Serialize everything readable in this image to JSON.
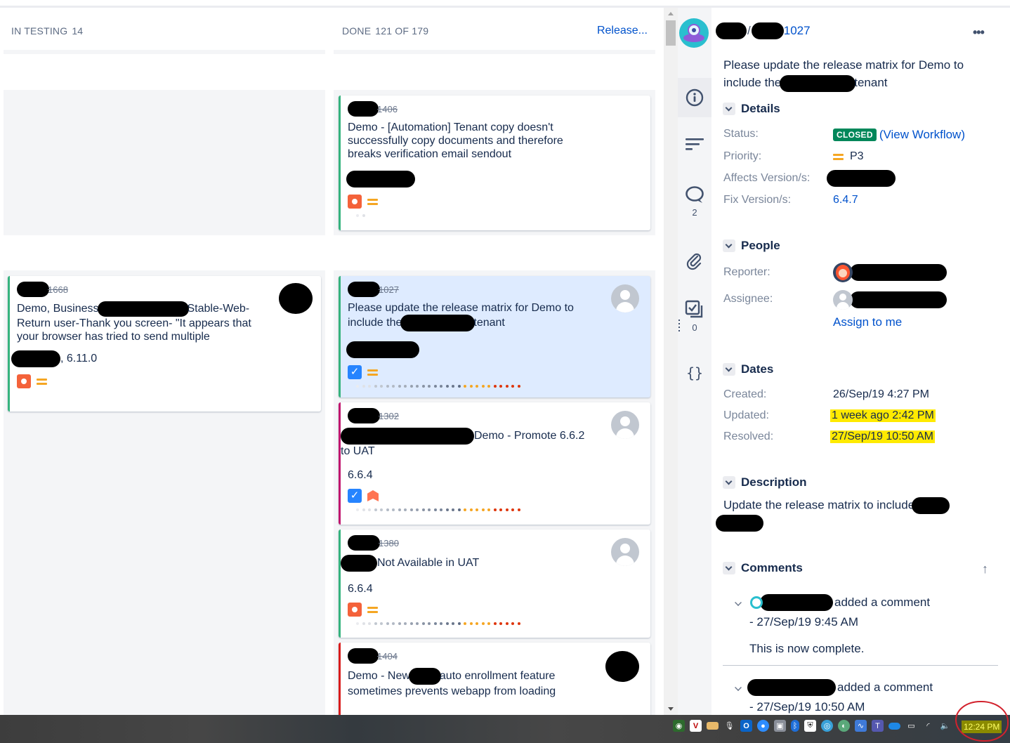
{
  "board": {
    "columns": [
      {
        "name": "IN TESTING",
        "count": "14"
      },
      {
        "name": "DONE",
        "count": "121 OF 179",
        "action_link": "Release..."
      }
    ],
    "cards": [
      {
        "key": "1406",
        "summary": "Demo - [Automation] Tenant copy doesn't successfully copy documents and therefore breaks verification email sendout",
        "version": "",
        "type": "bug",
        "priority": "medium",
        "border_color": "#36b37e",
        "selected": false
      },
      {
        "key": "1668",
        "summary_parts": [
          "Demo, Business",
          "Stable-Web-Return user-Thank you screen- \"It appears that your browser has tried to send multiple"
        ],
        "version": ", 6.11.0",
        "type": "bug",
        "priority": "medium",
        "border_color": "#36b37e",
        "selected": false
      },
      {
        "key": "1027",
        "summary_parts": [
          "Please update the release matrix for Demo to include the",
          "tenant"
        ],
        "version": "",
        "type": "task",
        "priority": "medium",
        "border_color": "#36b37e",
        "selected": true
      },
      {
        "key": "1302",
        "summary_parts": [
          "Demo - Promote 6.6.2 to UAT"
        ],
        "version": "6.6.4",
        "type": "task",
        "priority": "high",
        "border_color": "#c0166e",
        "selected": false
      },
      {
        "key": "1380",
        "summary_parts": [
          "Not Available in UAT"
        ],
        "version": "6.6.4",
        "type": "bug",
        "priority": "medium",
        "border_color": "#36b37e",
        "selected": false
      },
      {
        "key": "1404",
        "summary_parts": [
          "Demo - New",
          "auto enrollment feature sometimes prevents webapp from loading"
        ],
        "version": "",
        "type": "bug",
        "priority": "medium",
        "border_color": "#d91c1c",
        "selected": false
      }
    ],
    "days_in_column_dot_colors": [
      "#ebecf0",
      "#dfe1e6",
      "#dfe1e6",
      "#c1c7d0",
      "#c1c7d0",
      "#b3bac5",
      "#b3bac5",
      "#a5adba",
      "#a5adba",
      "#97a0af",
      "#97a0af",
      "#8993a4",
      "#8993a4",
      "#7a869a",
      "#7a869a",
      "#6b778c",
      "#6b778c",
      "#5e6c84",
      "#f5a623",
      "#f5a623",
      "#f5a623",
      "#f5a623",
      "#f5a623",
      "#de350b",
      "#de350b",
      "#de350b",
      "#de350b",
      "#de350b"
    ]
  },
  "rail": {
    "items": [
      {
        "icon": "info-icon",
        "count": ""
      },
      {
        "icon": "description-icon",
        "count": ""
      },
      {
        "icon": "comment-icon",
        "count": "2"
      },
      {
        "icon": "attachment-icon",
        "count": ""
      },
      {
        "icon": "subtasks-icon",
        "count": "0"
      },
      {
        "icon": "code-icon",
        "count": ""
      }
    ]
  },
  "detail": {
    "breadcrumb_sep": "/",
    "issue_key": "1027",
    "more": "•••",
    "title_parts": [
      "Please update the release matrix for Demo to include the",
      "tenant"
    ],
    "sections": {
      "details": "Details",
      "people": "People",
      "dates": "Dates",
      "description": "Description",
      "comments": "Comments"
    },
    "fields": {
      "status_label": "Status:",
      "status_value": "CLOSED",
      "status_link": "(View Workflow)",
      "priority_label": "Priority:",
      "priority_value": "P3",
      "affects_label": "Affects Version/s:",
      "fix_label": "Fix Version/s:",
      "fix_value": "6.4.7",
      "reporter_label": "Reporter:",
      "assignee_label": "Assignee:",
      "assign_to_me": "Assign to me",
      "created_label": "Created:",
      "created_value": "26/Sep/19 4:27 PM",
      "updated_label": "Updated:",
      "updated_value": "1 week ago 2:42 PM",
      "resolved_label": "Resolved:",
      "resolved_value": "27/Sep/19 10:50 AM"
    },
    "description": "Update the release matrix to include",
    "comments": [
      {
        "action": "added a comment",
        "date": "- 27/Sep/19 9:45 AM",
        "body": "This is now complete."
      },
      {
        "action": "added a comment",
        "date": "- 27/Sep/19 10:50 AM",
        "body": ""
      }
    ],
    "sort_arrow": "↑"
  },
  "taskbar": {
    "tray_icons": [
      "nvidia-icon",
      "app-v-icon",
      "mail-icon",
      "microphone-icon",
      "outlook-icon",
      "zoom-icon",
      "device-icon",
      "bluetooth-icon",
      "security-icon",
      "network-globe-icon",
      "browser-icon",
      "monitor-icon",
      "teams-icon",
      "onedrive-icon",
      "power-icon",
      "wifi-icon",
      "volume-icon"
    ],
    "clock": "12:24 PM"
  }
}
